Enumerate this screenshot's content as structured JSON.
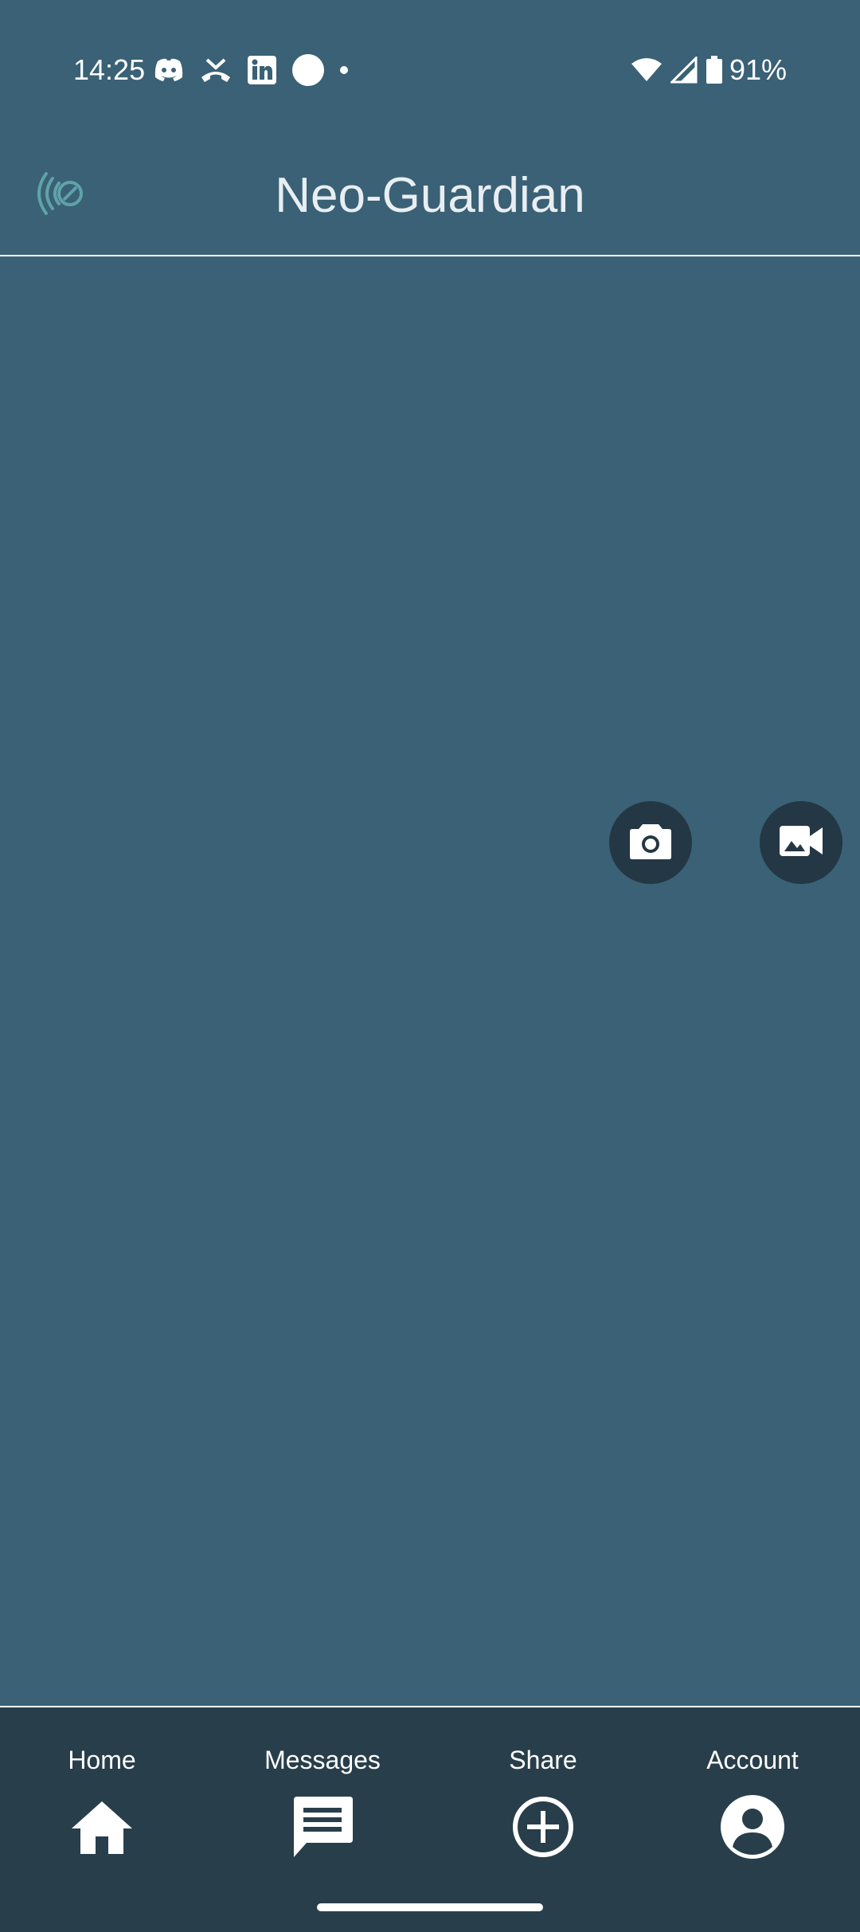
{
  "status_bar": {
    "time": "14:25",
    "battery": "91%",
    "notification_icons": [
      "discord-icon",
      "missed-call-icon",
      "linkedin-icon",
      "circle-app-icon",
      "more-notifications-dot-icon"
    ],
    "system_icons": [
      "wifi-icon",
      "cellular-signal-icon",
      "battery-icon"
    ]
  },
  "header": {
    "title": "Neo-Guardian",
    "logo_icon": "neo-guardian-logo-icon"
  },
  "actions": {
    "camera_icon": "camera-icon",
    "video_icon": "video-camera-icon"
  },
  "bottom_nav": {
    "items": [
      {
        "label": "Home",
        "icon": "home-icon"
      },
      {
        "label": "Messages",
        "icon": "message-icon"
      },
      {
        "label": "Share",
        "icon": "add-circle-icon"
      },
      {
        "label": "Account",
        "icon": "account-circle-icon"
      }
    ]
  },
  "colors": {
    "background": "#3a6175",
    "nav_background": "#283e4b",
    "fab_background": "#243744",
    "logo_accent": "#5fa3a8"
  }
}
